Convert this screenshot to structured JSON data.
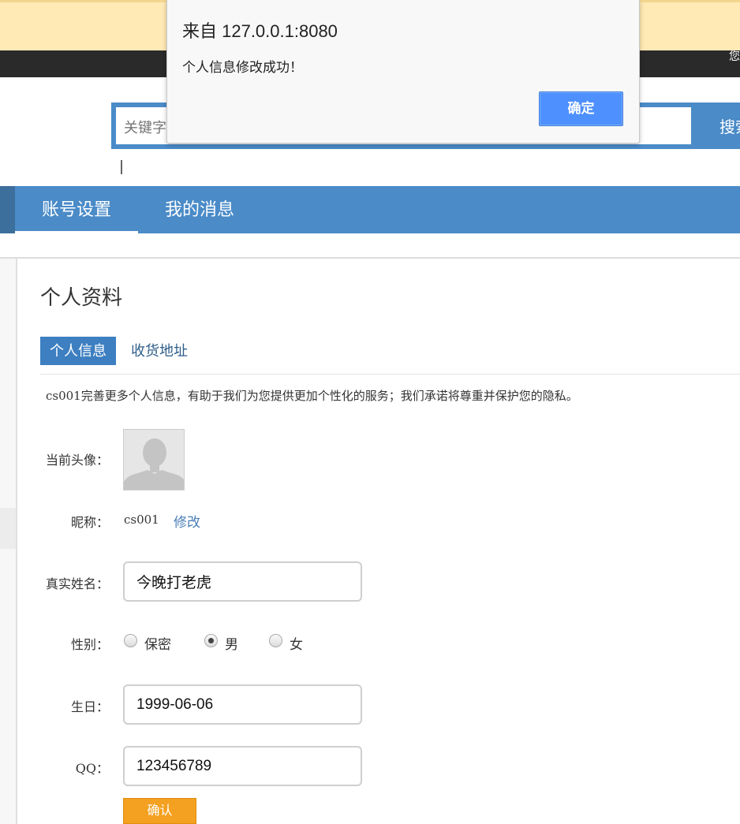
{
  "header": {
    "greeting_partial": "您"
  },
  "search": {
    "placeholder": "关键字",
    "button_label": "搜索"
  },
  "nav": {
    "tabs": [
      {
        "label": "账号设置",
        "active": true
      },
      {
        "label": "我的消息",
        "active": false
      }
    ]
  },
  "profile": {
    "section_title": "个人资料",
    "subtabs": [
      {
        "label": "个人信息",
        "active": true
      },
      {
        "label": "收货地址",
        "active": false
      }
    ],
    "intro": "cs001完善更多个人信息，有助于我们为您提供更加个性化的服务；我们承诺将尊重并保护您的隐私。",
    "avatar_label": "当前头像：",
    "nickname_label": "昵称：",
    "nickname_value": "cs001",
    "nickname_edit": "修改",
    "realname_label": "真实姓名：",
    "realname_value": "今晚打老虎",
    "gender_label": "性别：",
    "gender_options": [
      "保密",
      "男",
      "女"
    ],
    "gender_selected": "男",
    "birthday_label": "生日：",
    "birthday_value": "1999-06-06",
    "qq_label": "QQ：",
    "qq_value": "123456789",
    "confirm_label": "确认"
  },
  "dialog": {
    "origin": "来自 127.0.0.1:8080",
    "message": "个人信息修改成功！",
    "ok_label": "确定"
  },
  "colors": {
    "nav_blue": "#4a8bc8",
    "subtab_blue": "#3d7fc1",
    "confirm_orange": "#f4a020",
    "banner_yellow": "#ffe9b4",
    "dialog_button_blue": "#4d90fe"
  }
}
